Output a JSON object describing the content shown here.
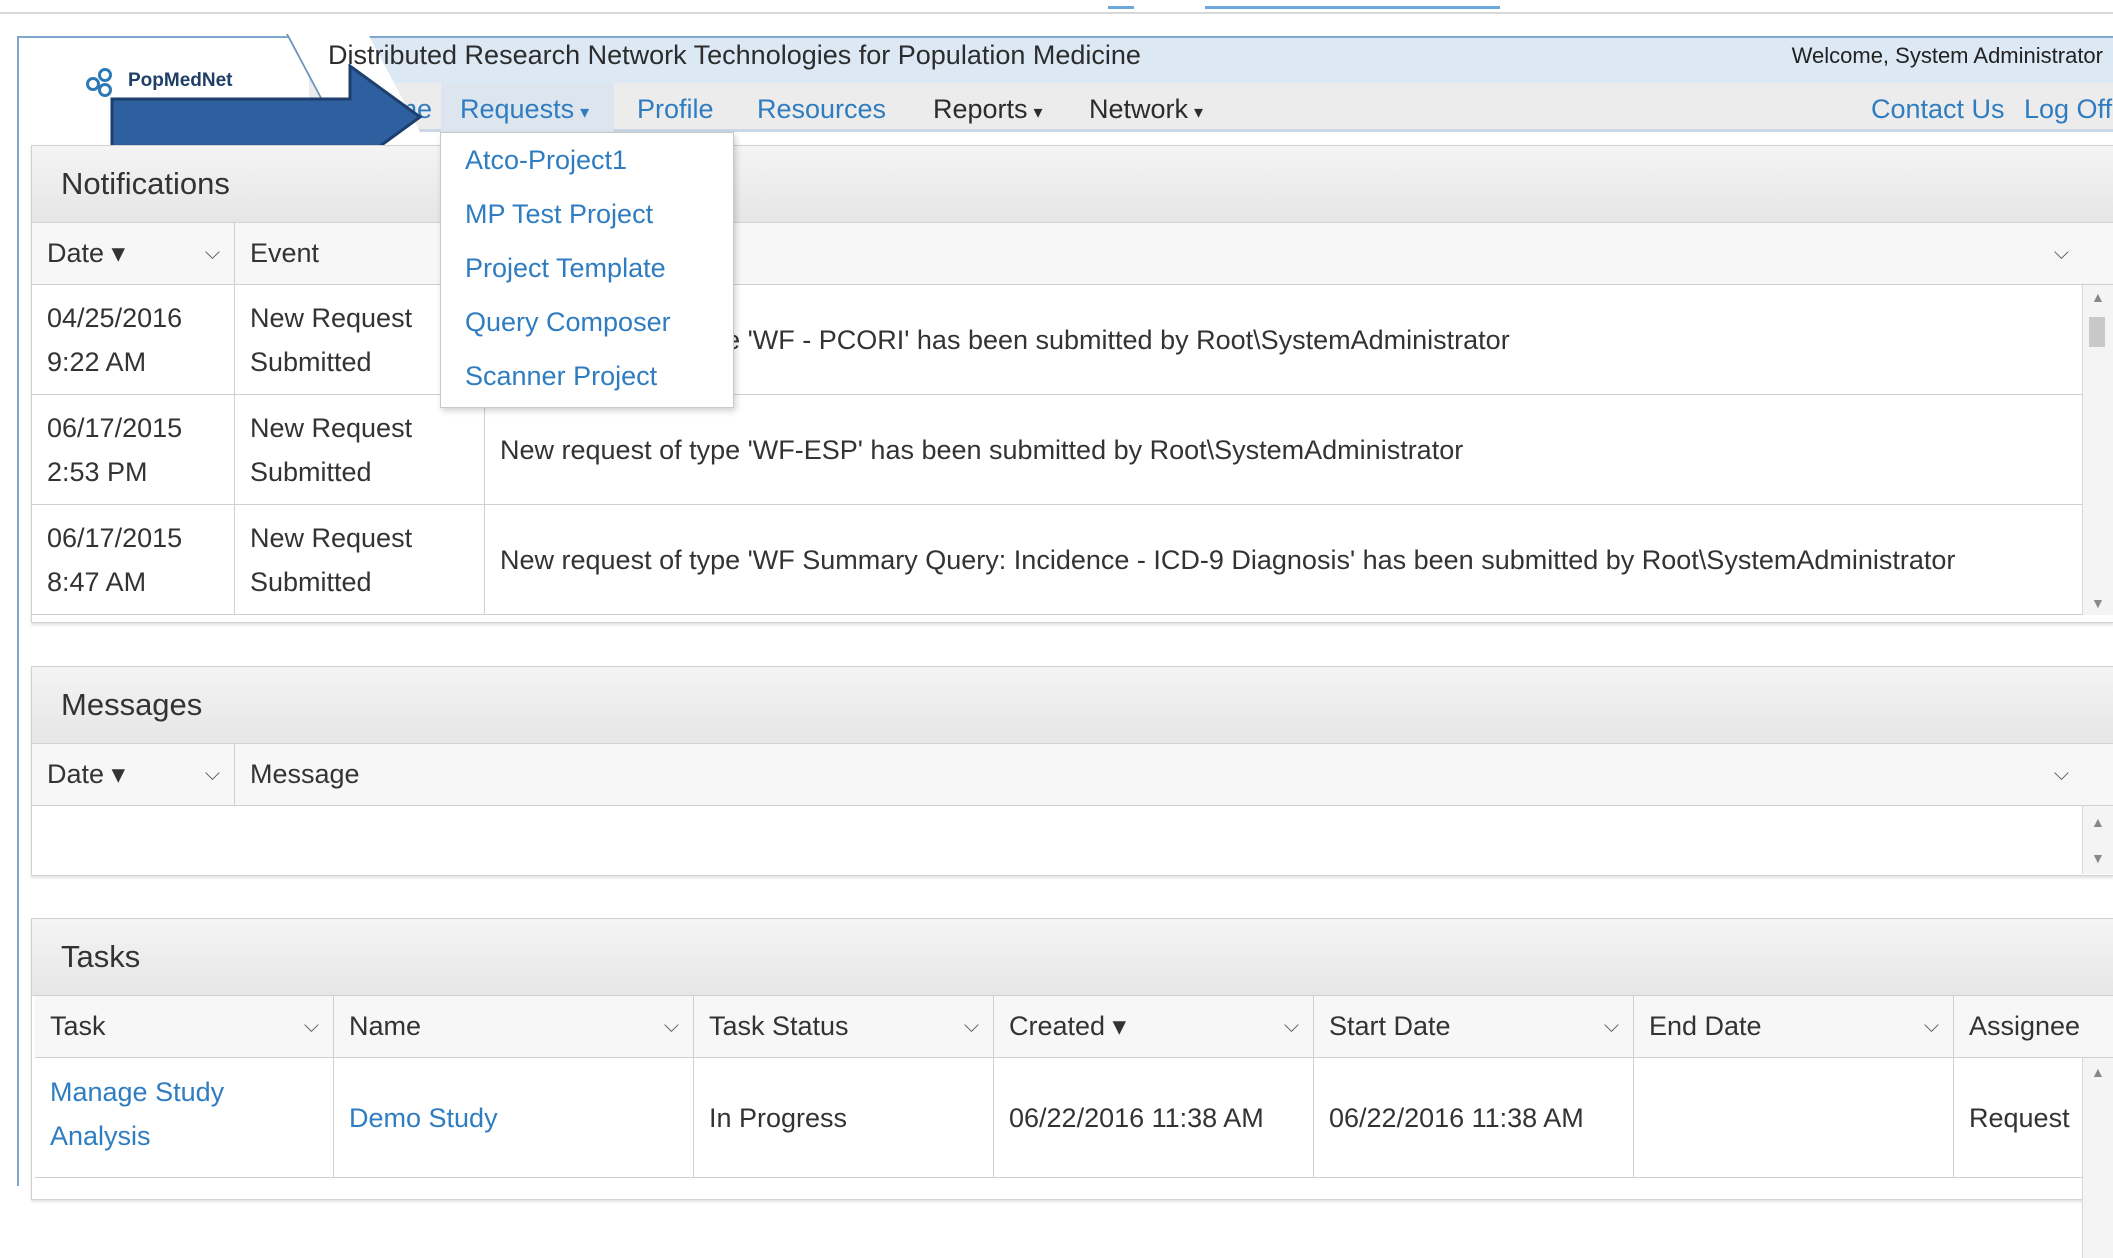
{
  "header": {
    "logo_text": "PopMedNet",
    "site_title": "Distributed Research Network Technologies for Population Medicine",
    "welcome": "Welcome, System Administrator"
  },
  "nav": {
    "home": "Home",
    "requests": "Requests",
    "profile": "Profile",
    "resources": "Resources",
    "reports": "Reports",
    "network": "Network",
    "contact": "Contact Us",
    "logoff": "Log Off",
    "caret": "▾"
  },
  "requests_menu": [
    "Atco-Project1",
    "MP Test Project",
    "Project Template",
    "Query Composer",
    "Scanner Project"
  ],
  "notifications": {
    "title": "Notifications",
    "columns": [
      "Date ▾",
      "Event",
      ""
    ],
    "rows": [
      {
        "date": "04/25/2016",
        "time": "9:22 AM",
        "event1": "New Request",
        "event2": "Submitted",
        "text": "New request of type 'WF - PCORI' has been submitted by Root\\SystemAdministrator"
      },
      {
        "date": "06/17/2015",
        "time": "2:53 PM",
        "event1": "New Request",
        "event2": "Submitted",
        "text": "New request of type 'WF-ESP' has been submitted by Root\\SystemAdministrator"
      },
      {
        "date": "06/17/2015",
        "time": "8:47 AM",
        "event1": "New Request",
        "event2": "Submitted",
        "text": "New request of type 'WF Summary Query: Incidence - ICD-9 Diagnosis' has been submitted by Root\\SystemAdministrator"
      }
    ]
  },
  "messages": {
    "title": "Messages",
    "columns": [
      "Date ▾",
      "Message"
    ]
  },
  "tasks": {
    "title": "Tasks",
    "columns": [
      "Task",
      "Name",
      "Task Status",
      "Created ▾",
      "Start Date",
      "End Date",
      "Assignee"
    ],
    "rows": [
      {
        "task1": "Manage Study",
        "task2": "Analysis",
        "name": "Demo Study",
        "status": "In Progress",
        "created": "06/22/2016 11:38 AM",
        "start": "06/22/2016 11:38 AM",
        "end": "",
        "assignee": "Request"
      }
    ]
  },
  "colors": {
    "accent": "#2f7dc0",
    "arrow": "#2e5f9e",
    "header_band": "#dde8f5"
  }
}
